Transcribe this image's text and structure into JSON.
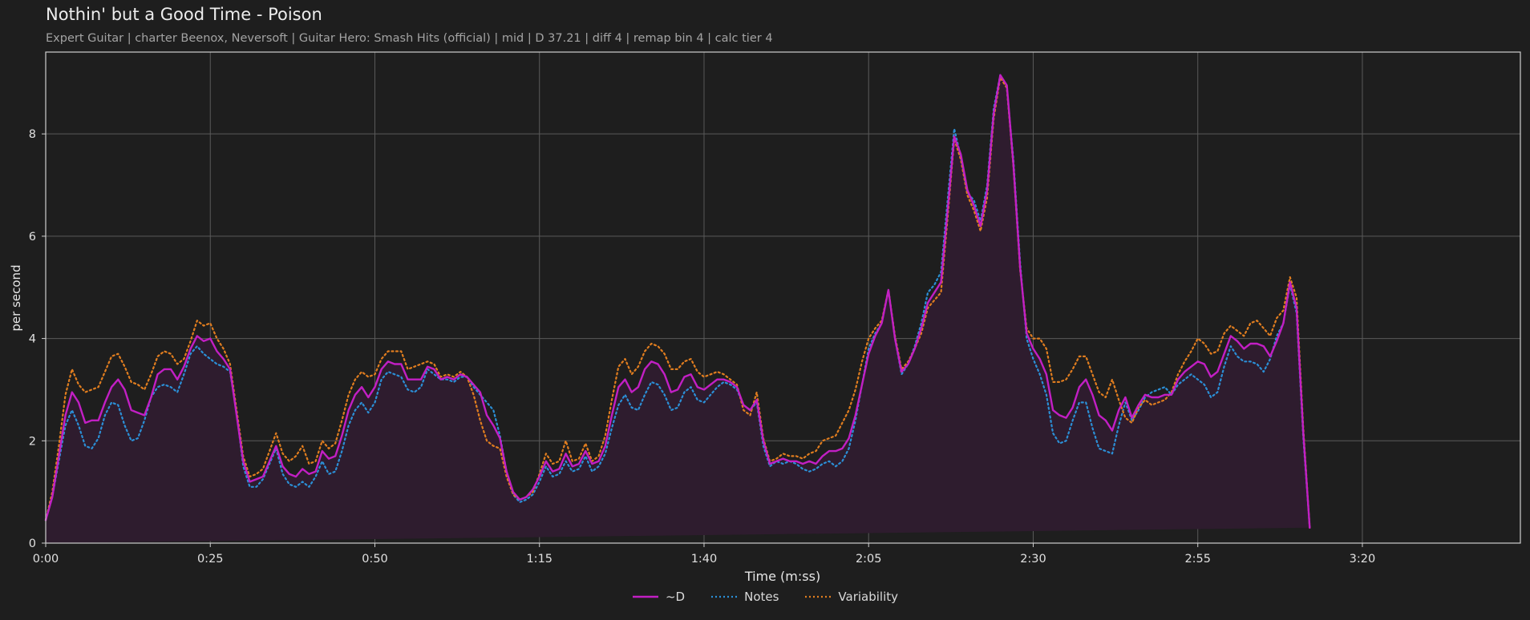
{
  "title": "Nothin' but a Good Time - Poison",
  "subtitle": "Expert Guitar  |  charter Beenox,  Neversoft  |  Guitar Hero: Smash Hits (official)  |  mid  |  D 37.21  |  diff 4  |  remap bin 4  |  calc tier 4",
  "colors": {
    "background": "#1e1e1e",
    "d_line": "#c21fc4",
    "notes_line": "#2b8fd6",
    "variability_line": "#e07d1f",
    "fill": "#2e1c2e",
    "grid": "#5a5a5a",
    "axis": "#cfcfcf"
  },
  "chart_data": {
    "type": "line",
    "xlabel": "Time (m:ss)",
    "ylabel": "per second",
    "xlim": [
      0,
      224
    ],
    "ylim": [
      0,
      9.6
    ],
    "x_ticks": [
      0,
      25,
      50,
      75,
      100,
      125,
      150,
      175,
      200
    ],
    "x_tick_labels": [
      "0:00",
      "0:25",
      "0:50",
      "1:15",
      "1:40",
      "2:05",
      "2:30",
      "2:55",
      "3:20"
    ],
    "y_ticks": [
      0,
      2,
      4,
      6,
      8
    ],
    "y_tick_labels": [
      "0",
      "2",
      "4",
      "6",
      "8"
    ],
    "grid": true,
    "legend_position": "bottom-center",
    "x": [
      0,
      1,
      2,
      3,
      4,
      5,
      6,
      7,
      8,
      9,
      10,
      11,
      12,
      13,
      14,
      15,
      16,
      17,
      18,
      19,
      20,
      21,
      22,
      23,
      24,
      25,
      26,
      27,
      28,
      29,
      30,
      31,
      32,
      33,
      34,
      35,
      36,
      37,
      38,
      39,
      40,
      41,
      42,
      43,
      44,
      45,
      46,
      47,
      48,
      49,
      50,
      51,
      52,
      53,
      54,
      55,
      56,
      57,
      58,
      59,
      60,
      61,
      62,
      63,
      64,
      65,
      66,
      67,
      68,
      69,
      70,
      71,
      72,
      73,
      74,
      75,
      76,
      77,
      78,
      79,
      80,
      81,
      82,
      83,
      84,
      85,
      86,
      87,
      88,
      89,
      90,
      91,
      92,
      93,
      94,
      95,
      96,
      97,
      98,
      99,
      100,
      101,
      102,
      103,
      104,
      105,
      106,
      107,
      108,
      109,
      110,
      111,
      112,
      113,
      114,
      115,
      116,
      117,
      118,
      119,
      120,
      121,
      122,
      123,
      124,
      125,
      126,
      127,
      128,
      129,
      130,
      131,
      132,
      133,
      134,
      135,
      136,
      137,
      138,
      139,
      140,
      141,
      142,
      143,
      144,
      145,
      146,
      147,
      148,
      149,
      150,
      151,
      152,
      153,
      154,
      155,
      156,
      157,
      158,
      159,
      160,
      161,
      162,
      163,
      164,
      165,
      166,
      167,
      168,
      169,
      170,
      171,
      172,
      173,
      174,
      175,
      176,
      177,
      178,
      179,
      180,
      181,
      182,
      183,
      184,
      185,
      186,
      187,
      188,
      189,
      190,
      191,
      192,
      193,
      194,
      195,
      196,
      197,
      198,
      199,
      200,
      201,
      202,
      203,
      204,
      205,
      206,
      207,
      208,
      209,
      210,
      211,
      212,
      213,
      214,
      215,
      216,
      217,
      218,
      219,
      220,
      221,
      222,
      223,
      224
    ],
    "series": [
      {
        "name": "~D",
        "style": "solid",
        "values": [
          0.45,
          0.9,
          1.7,
          2.5,
          2.95,
          2.75,
          2.35,
          2.4,
          2.4,
          2.75,
          3.05,
          3.2,
          3.0,
          2.6,
          2.55,
          2.5,
          2.85,
          3.3,
          3.4,
          3.4,
          3.2,
          3.45,
          3.8,
          4.05,
          3.95,
          4.0,
          3.75,
          3.6,
          3.4,
          2.5,
          1.6,
          1.2,
          1.25,
          1.3,
          1.6,
          1.9,
          1.5,
          1.35,
          1.3,
          1.45,
          1.35,
          1.4,
          1.8,
          1.65,
          1.7,
          2.1,
          2.6,
          2.9,
          3.05,
          2.85,
          3.05,
          3.4,
          3.55,
          3.5,
          3.5,
          3.2,
          3.2,
          3.2,
          3.45,
          3.4,
          3.2,
          3.25,
          3.2,
          3.3,
          3.25,
          3.1,
          2.95,
          2.5,
          2.3,
          2.05,
          1.4,
          1.0,
          0.85,
          0.9,
          1.05,
          1.3,
          1.6,
          1.4,
          1.45,
          1.75,
          1.5,
          1.55,
          1.8,
          1.55,
          1.6,
          1.9,
          2.5,
          3.05,
          3.2,
          2.95,
          3.05,
          3.4,
          3.55,
          3.5,
          3.3,
          2.95,
          3.0,
          3.25,
          3.3,
          3.05,
          3.0,
          3.1,
          3.2,
          3.2,
          3.15,
          3.05,
          2.7,
          2.6,
          2.8,
          2.0,
          1.55,
          1.6,
          1.65,
          1.6,
          1.6,
          1.55,
          1.6,
          1.55,
          1.7,
          1.8,
          1.8,
          1.85,
          2.05,
          2.5,
          3.1,
          3.7,
          4.05,
          4.3,
          4.95,
          4.0,
          3.35,
          3.5,
          3.8,
          4.2,
          4.7,
          4.9,
          5.1,
          6.5,
          7.95,
          7.6,
          6.9,
          6.6,
          6.2,
          6.9,
          8.4,
          9.15,
          8.95,
          7.4,
          5.4,
          4.1,
          3.8,
          3.6,
          3.3,
          2.6,
          2.5,
          2.45,
          2.65,
          3.05,
          3.2,
          2.9,
          2.5,
          2.4,
          2.2,
          2.6,
          2.85,
          2.45,
          2.7,
          2.9,
          2.85,
          2.85,
          2.9,
          2.9,
          3.2,
          3.35,
          3.45,
          3.55,
          3.5,
          3.25,
          3.35,
          3.7,
          4.05,
          3.95,
          3.8,
          3.9,
          3.9,
          3.85,
          3.65,
          3.95,
          4.3,
          5.1,
          4.6,
          2.2,
          0.3
        ]
      },
      {
        "name": "Notes",
        "style": "dotted",
        "values": [
          0.45,
          0.9,
          1.6,
          2.3,
          2.6,
          2.3,
          1.9,
          1.85,
          2.05,
          2.5,
          2.75,
          2.7,
          2.3,
          2.0,
          2.05,
          2.4,
          2.85,
          3.05,
          3.1,
          3.05,
          2.95,
          3.3,
          3.7,
          3.85,
          3.7,
          3.6,
          3.5,
          3.45,
          3.35,
          2.55,
          1.5,
          1.1,
          1.1,
          1.25,
          1.55,
          1.85,
          1.35,
          1.15,
          1.1,
          1.2,
          1.1,
          1.3,
          1.6,
          1.35,
          1.4,
          1.8,
          2.3,
          2.6,
          2.75,
          2.55,
          2.75,
          3.2,
          3.35,
          3.3,
          3.25,
          3.0,
          2.95,
          3.05,
          3.4,
          3.3,
          3.2,
          3.2,
          3.15,
          3.25,
          3.25,
          3.05,
          2.9,
          2.75,
          2.6,
          2.1,
          1.4,
          0.95,
          0.8,
          0.85,
          0.95,
          1.2,
          1.5,
          1.3,
          1.35,
          1.6,
          1.4,
          1.45,
          1.7,
          1.4,
          1.5,
          1.75,
          2.25,
          2.7,
          2.9,
          2.65,
          2.6,
          2.9,
          3.15,
          3.1,
          2.9,
          2.6,
          2.65,
          2.95,
          3.05,
          2.8,
          2.75,
          2.9,
          3.05,
          3.15,
          3.1,
          3.0,
          2.7,
          2.6,
          2.75,
          1.9,
          1.5,
          1.6,
          1.55,
          1.6,
          1.55,
          1.45,
          1.4,
          1.45,
          1.55,
          1.6,
          1.5,
          1.6,
          1.85,
          2.4,
          3.1,
          3.8,
          4.1,
          4.3,
          4.95,
          4.0,
          3.3,
          3.5,
          3.85,
          4.3,
          4.9,
          5.05,
          5.3,
          6.7,
          8.1,
          7.55,
          6.85,
          6.7,
          6.3,
          7.0,
          8.5,
          9.15,
          8.9,
          7.5,
          5.5,
          4.0,
          3.6,
          3.3,
          2.9,
          2.15,
          1.95,
          2.0,
          2.4,
          2.75,
          2.75,
          2.25,
          1.85,
          1.8,
          1.75,
          2.3,
          2.75,
          2.4,
          2.6,
          2.85,
          2.95,
          3.0,
          3.05,
          2.9,
          3.1,
          3.2,
          3.3,
          3.2,
          3.1,
          2.85,
          2.95,
          3.45,
          3.85,
          3.65,
          3.55,
          3.55,
          3.5,
          3.35,
          3.6,
          4.05,
          4.3,
          5.05,
          4.5,
          2.1,
          0.3
        ]
      },
      {
        "name": "Variability",
        "style": "dotted",
        "values": [
          0.45,
          1.0,
          1.9,
          2.9,
          3.4,
          3.1,
          2.95,
          3.0,
          3.05,
          3.35,
          3.65,
          3.7,
          3.45,
          3.15,
          3.1,
          3.0,
          3.3,
          3.65,
          3.75,
          3.7,
          3.5,
          3.6,
          3.95,
          4.35,
          4.25,
          4.3,
          4.0,
          3.8,
          3.5,
          2.6,
          1.7,
          1.3,
          1.35,
          1.45,
          1.8,
          2.15,
          1.75,
          1.6,
          1.7,
          1.9,
          1.55,
          1.6,
          2.0,
          1.85,
          1.95,
          2.4,
          2.9,
          3.2,
          3.35,
          3.25,
          3.3,
          3.6,
          3.75,
          3.75,
          3.75,
          3.4,
          3.45,
          3.5,
          3.55,
          3.5,
          3.25,
          3.3,
          3.25,
          3.35,
          3.25,
          2.9,
          2.4,
          2.0,
          1.9,
          1.85,
          1.3,
          0.95,
          0.85,
          0.9,
          1.0,
          1.35,
          1.75,
          1.55,
          1.6,
          2.0,
          1.6,
          1.65,
          1.95,
          1.6,
          1.7,
          2.1,
          2.8,
          3.45,
          3.6,
          3.3,
          3.45,
          3.75,
          3.9,
          3.85,
          3.7,
          3.4,
          3.4,
          3.55,
          3.6,
          3.35,
          3.25,
          3.3,
          3.35,
          3.3,
          3.2,
          3.1,
          2.6,
          2.5,
          2.95,
          2.05,
          1.6,
          1.65,
          1.75,
          1.7,
          1.7,
          1.65,
          1.75,
          1.8,
          2.0,
          2.05,
          2.1,
          2.35,
          2.6,
          3.0,
          3.55,
          4.0,
          4.2,
          4.35,
          4.95,
          4.05,
          3.4,
          3.55,
          3.8,
          4.1,
          4.6,
          4.75,
          4.9,
          6.35,
          7.9,
          7.5,
          6.8,
          6.5,
          6.1,
          6.75,
          8.3,
          9.1,
          8.9,
          7.35,
          5.35,
          4.2,
          4.0,
          4.0,
          3.8,
          3.15,
          3.15,
          3.2,
          3.4,
          3.65,
          3.65,
          3.3,
          2.95,
          2.85,
          3.2,
          2.8,
          2.45,
          2.35,
          2.65,
          2.8,
          2.7,
          2.75,
          2.8,
          2.95,
          3.3,
          3.55,
          3.75,
          4.0,
          3.9,
          3.7,
          3.75,
          4.1,
          4.25,
          4.15,
          4.05,
          4.3,
          4.35,
          4.2,
          4.05,
          4.4,
          4.55,
          5.2,
          4.8,
          2.3,
          0.3
        ]
      }
    ]
  }
}
